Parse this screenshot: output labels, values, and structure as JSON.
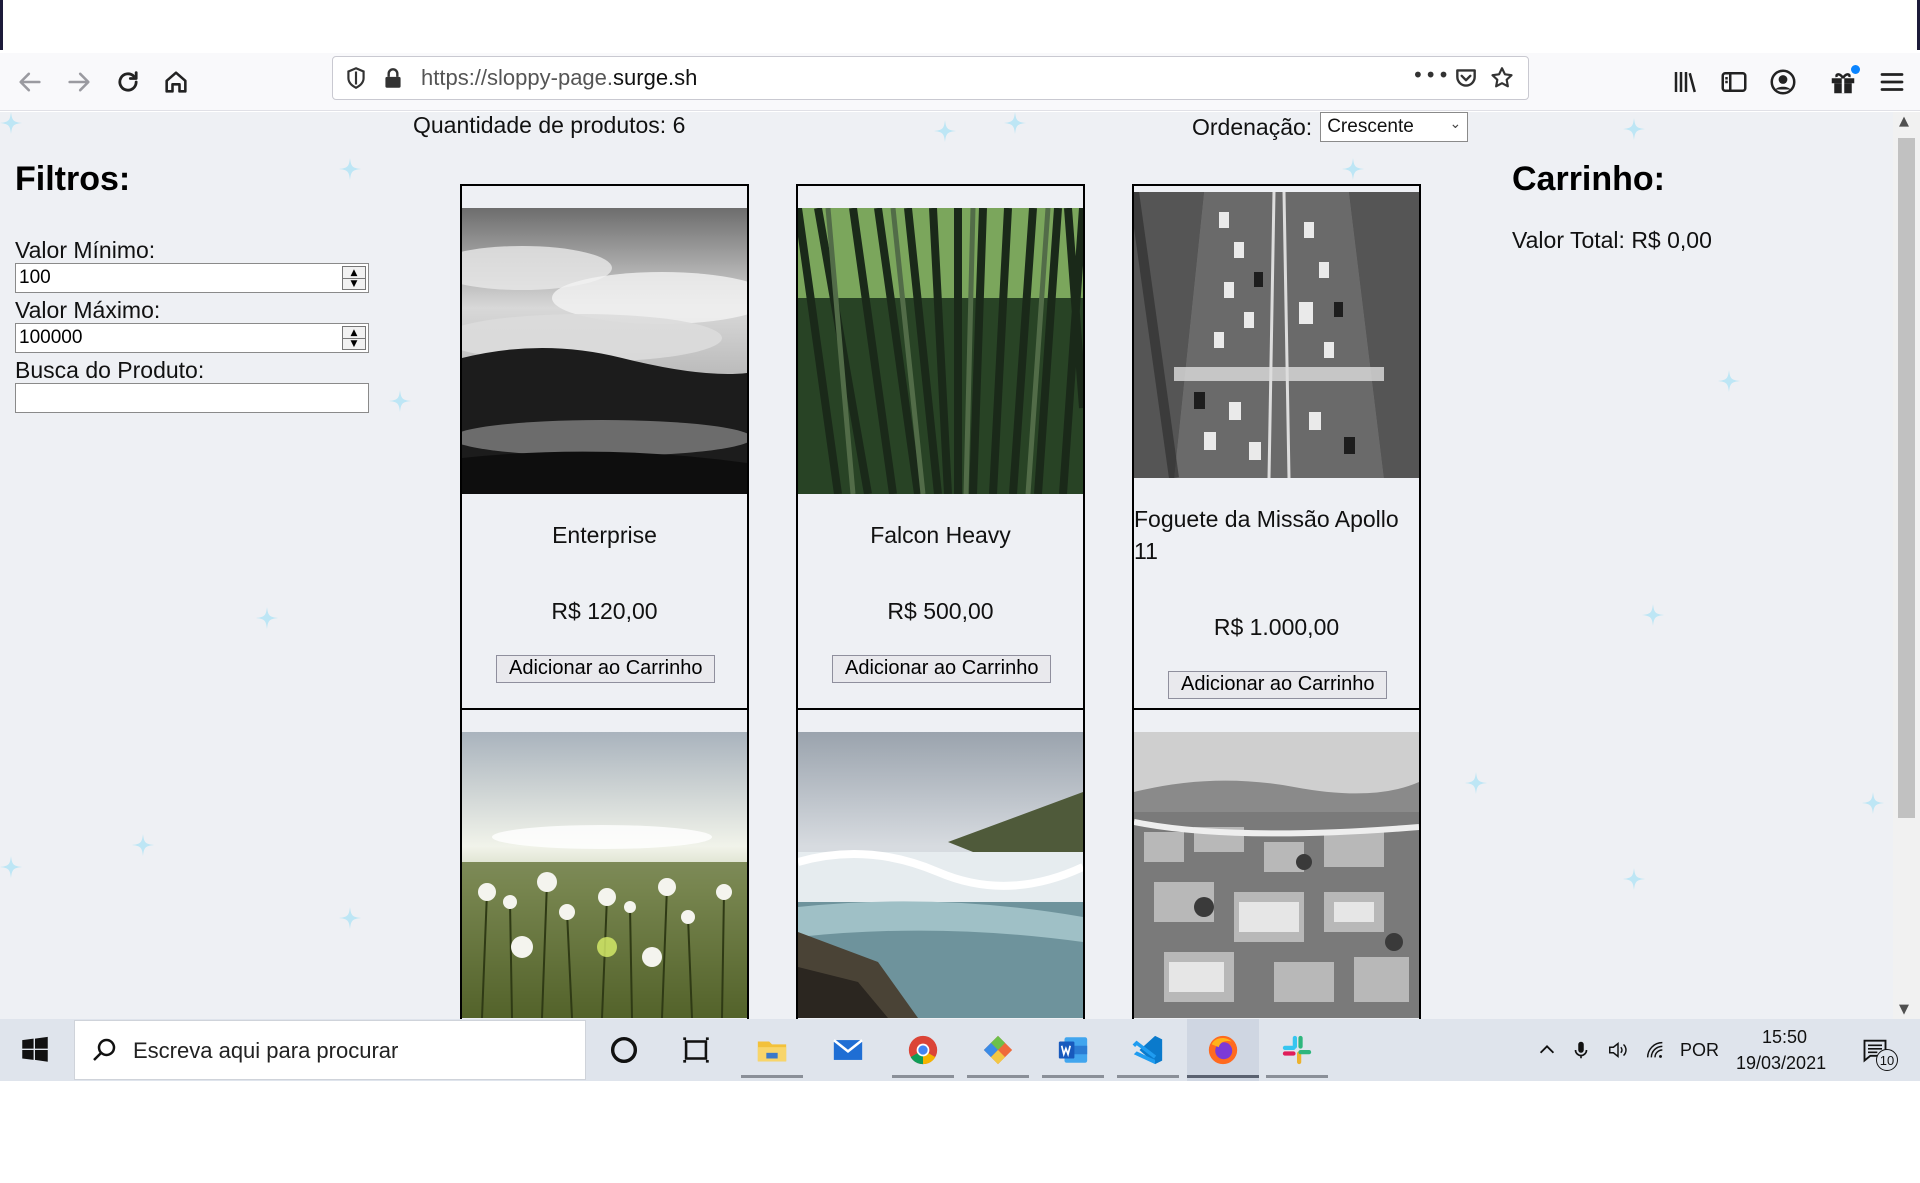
{
  "browser": {
    "url_prefix": "https://sloppy-page.",
    "url_domain": "surge.sh",
    "menu_dots": "•••"
  },
  "header": {
    "quantity_label": "Quantidade de produtos: 6",
    "order_label": "Ordenação:",
    "order_selected": "Crescente"
  },
  "filters": {
    "title": "Filtros:",
    "min_label": "Valor Mínimo:",
    "min_value": "100",
    "max_label": "Valor Máximo:",
    "max_value": "100000",
    "search_label": "Busca do Produto:",
    "search_value": ""
  },
  "products": [
    {
      "name": "Enterprise",
      "price": "R$ 120,00",
      "button": "Adicionar ao Carrinho",
      "image": "cloudy-hills-bw"
    },
    {
      "name": "Falcon Heavy",
      "price": "R$ 500,00",
      "button": "Adicionar ao Carrinho",
      "image": "bamboo-forest"
    },
    {
      "name": "Foguete da Missão Apollo 11",
      "price": "R$ 1.000,00",
      "button": "Adicionar ao Carrinho",
      "image": "highway-traffic-bw"
    },
    {
      "name": "",
      "price": "",
      "button": "",
      "image": "dandelion-field"
    },
    {
      "name": "",
      "price": "",
      "button": "",
      "image": "waterfall-river"
    },
    {
      "name": "",
      "price": "",
      "button": "",
      "image": "city-aerial-bw"
    }
  ],
  "cart": {
    "title": "Carrinho:",
    "total_label": "Valor Total: R$ 0,00"
  },
  "taskbar": {
    "search_placeholder": "Escreva aqui para procurar",
    "language": "POR",
    "time": "15:50",
    "date": "19/03/2021",
    "notifications": "10"
  },
  "colors": {
    "page_bg": "#eef0f4",
    "sparkle": "#bde6f5",
    "accent": "#0a84ff"
  }
}
